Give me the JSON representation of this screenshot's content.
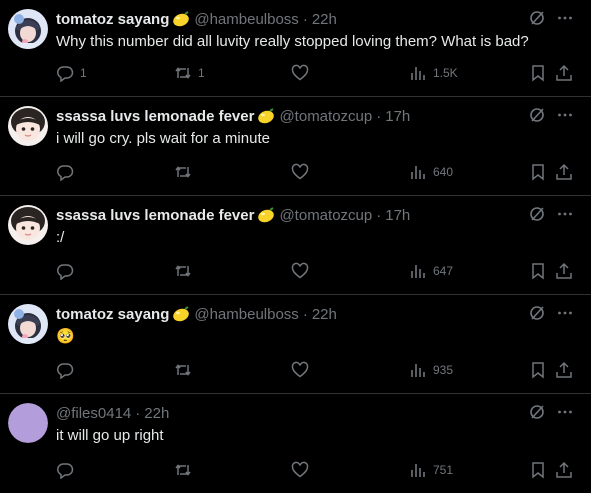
{
  "tweets": [
    {
      "name": "tomatoz sayang",
      "handle": "@hambeulboss",
      "dot": "·",
      "time": "22h",
      "text": "Why this number did all luvity really stopped loving them? What is bad?",
      "reply_count": "1",
      "retweet_count": "1",
      "like_count": "",
      "view_count": "1.5K",
      "emoji_badge": "lemon",
      "avatar": "anime-avatar"
    },
    {
      "name": "ssassa luvs lemonade fever",
      "handle": "@tomatozcup",
      "dot": "·",
      "time": "17h",
      "text": "i will go cry. pls  wait for a minute",
      "reply_count": "",
      "retweet_count": "",
      "like_count": "",
      "view_count": "640",
      "emoji_badge": "lemon",
      "avatar": "doll-avatar"
    },
    {
      "name": "ssassa luvs lemonade fever",
      "handle": "@tomatozcup",
      "dot": "·",
      "time": "17h",
      "text": ":/",
      "reply_count": "",
      "retweet_count": "",
      "like_count": "",
      "view_count": "647",
      "emoji_badge": "lemon",
      "avatar": "doll-avatar"
    },
    {
      "name": "tomatoz sayang",
      "handle": "@hambeulboss",
      "dot": "·",
      "time": "22h",
      "text": "🥺",
      "reply_count": "",
      "retweet_count": "",
      "like_count": "",
      "view_count": "935",
      "emoji_badge": "lemon",
      "avatar": "anime-avatar"
    },
    {
      "name": "",
      "handle": "@files0414",
      "dot": "·",
      "time": "22h",
      "text": "it will go up right",
      "reply_count": "",
      "retweet_count": "",
      "like_count": "",
      "view_count": "751",
      "emoji_badge": "",
      "avatar": "purple-default-avatar"
    }
  ],
  "colors": {
    "background": "#000000",
    "text": "#e7e9ea",
    "muted": "#71767b",
    "divider": "#2f3336",
    "default_avatar": "#b39ddb"
  },
  "icons": [
    "reply-icon",
    "retweet-icon",
    "like-icon",
    "views-icon",
    "bookmark-icon",
    "share-icon",
    "grok-icon",
    "more-icon",
    "lemon-icon"
  ]
}
